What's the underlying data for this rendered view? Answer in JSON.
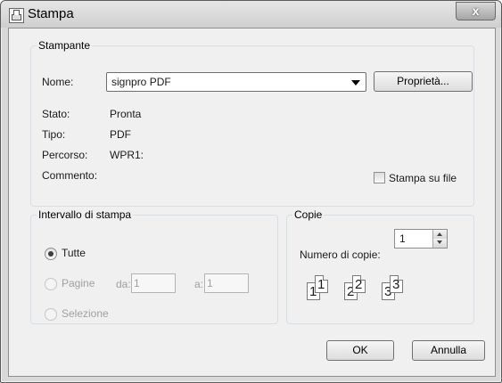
{
  "window": {
    "title": "Stampa",
    "close_label": "x"
  },
  "printer": {
    "legend": "Stampante",
    "name_label": "Nome:",
    "name_value": "signpro PDF",
    "properties_button": "Proprietà...",
    "status_label": "Stato:",
    "status_value": "Pronta",
    "type_label": "Tipo:",
    "type_value": "PDF",
    "path_label": "Percorso:",
    "path_value": "WPR1:",
    "comment_label": "Commento:",
    "print_to_file_label": "Stampa su file",
    "print_to_file_checked": false
  },
  "range": {
    "legend": "Intervallo di stampa",
    "all_label": "Tutte",
    "pages_label": "Pagine",
    "from_label": "da:",
    "from_value": "1",
    "to_label": "a:",
    "to_value": "1",
    "selection_label": "Selezione",
    "selected": "all"
  },
  "copies": {
    "legend": "Copie",
    "count_label": "Numero di copie:",
    "count_value": "1",
    "collate_pages": [
      "1",
      "1",
      "2",
      "2",
      "3",
      "3"
    ]
  },
  "buttons": {
    "ok": "OK",
    "cancel": "Annulla"
  }
}
